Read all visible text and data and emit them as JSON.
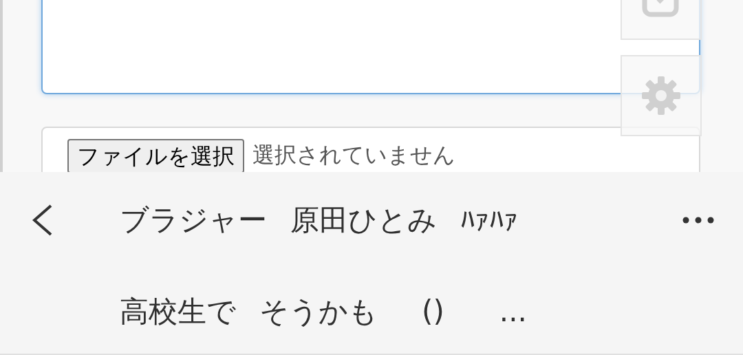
{
  "file_input": {
    "button_label": "ファイルを選択",
    "status": "選択されていません"
  },
  "side_buttons": [
    {
      "kind": "edit"
    },
    {
      "kind": "settings"
    }
  ],
  "keyboard_suggestions": {
    "first_line": [
      "ブラジャー",
      "原田ひとみ",
      "ﾊｧﾊｧ"
    ],
    "second_line": [
      "高校生で",
      "そうかも",
      "()",
      "..."
    ]
  }
}
